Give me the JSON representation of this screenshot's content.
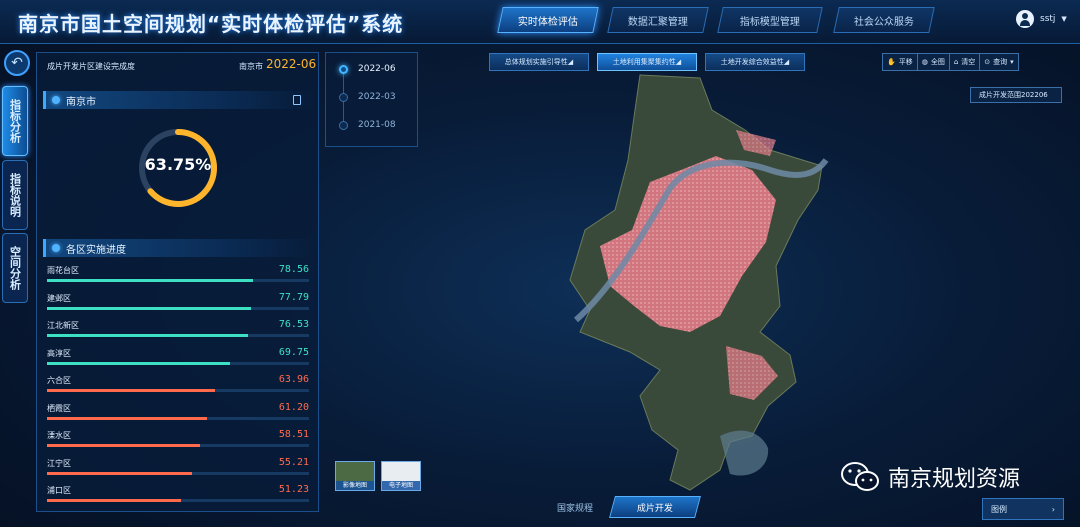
{
  "header": {
    "title": "南京市国土空间规划“实时体检评估”系统",
    "nav": [
      "实时体检评估",
      "数据汇聚管理",
      "指标模型管理",
      "社会公众服务"
    ],
    "active_nav": "实时体检评估",
    "user": "sstj"
  },
  "sidebar": {
    "tabs": [
      {
        "label": "指标分析",
        "active": true
      },
      {
        "label": "指标说明",
        "active": false
      },
      {
        "label": "空间分析",
        "active": false
      }
    ]
  },
  "panel": {
    "label": "成片开发片区建设完成度",
    "city": "南京市",
    "date": "2022-06",
    "summary_title": "南京市",
    "gauge_value": "63.75%",
    "gauge_fraction": 0.6375,
    "districts_title": "各区实施进度",
    "districts": [
      {
        "name": "雨花台区",
        "value": "78.56",
        "fraction": 0.7856,
        "color": "#3ee0c4"
      },
      {
        "name": "建邺区",
        "value": "77.79",
        "fraction": 0.7779,
        "color": "#3ee0c4"
      },
      {
        "name": "江北新区",
        "value": "76.53",
        "fraction": 0.7653,
        "color": "#3ee0c4"
      },
      {
        "name": "高淳区",
        "value": "69.75",
        "fraction": 0.6975,
        "color": "#3ee0c4"
      },
      {
        "name": "六合区",
        "value": "63.96",
        "fraction": 0.6396,
        "color": "#ff6a4d"
      },
      {
        "name": "栖霞区",
        "value": "61.20",
        "fraction": 0.612,
        "color": "#ff6a4d"
      },
      {
        "name": "溧水区",
        "value": "58.51",
        "fraction": 0.5851,
        "color": "#ff6a4d"
      },
      {
        "name": "江宁区",
        "value": "55.21",
        "fraction": 0.5521,
        "color": "#ff6a4d"
      },
      {
        "name": "浦口区",
        "value": "51.23",
        "fraction": 0.5123,
        "color": "#ff6a4d"
      }
    ],
    "colors": {
      "high": "#3ee0c4",
      "low": "#ff6a4d",
      "accent": "#ffb52b"
    }
  },
  "timeline": [
    {
      "date": "2022-06",
      "active": true
    },
    {
      "date": "2022-03",
      "active": false
    },
    {
      "date": "2021-08",
      "active": false
    }
  ],
  "map_tabs": [
    {
      "label": "总体规划实施引导性",
      "active": false
    },
    {
      "label": "土地利用集聚集约性",
      "active": true
    },
    {
      "label": "土地开发综合效益性",
      "active": false
    }
  ],
  "tools": [
    {
      "icon": "hand-icon",
      "label": "平移"
    },
    {
      "icon": "globe-icon",
      "label": "全图"
    },
    {
      "icon": "broom-icon",
      "label": "清空"
    },
    {
      "icon": "query-icon",
      "label": "查询"
    }
  ],
  "layer_select": "成片开发范围202206",
  "basemaps": [
    {
      "label": "影像地图",
      "active": true
    },
    {
      "label": "电子地图",
      "active": false
    }
  ],
  "bottom_tabs": [
    {
      "label": "国家规程",
      "active": false
    },
    {
      "label": "成片开发",
      "active": true
    }
  ],
  "watermark": "南京规划资源",
  "legend": "图例"
}
